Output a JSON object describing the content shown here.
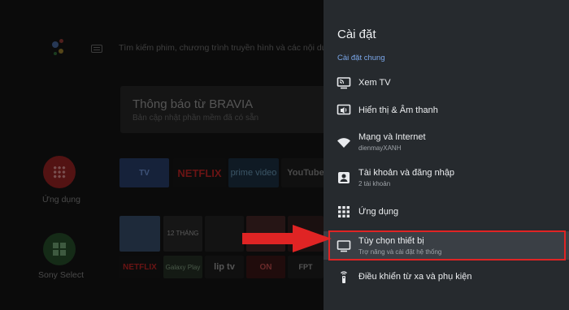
{
  "home": {
    "search_hint": "Tìm kiếm phim, chương trình truyền hình và các nội dung khác",
    "notification": {
      "title": "Thông báo từ BRAVIA",
      "subtitle": "Bản cập nhật phần mềm đã có sẵn"
    },
    "apps_label": "Ứng dụng",
    "sony_select_label": "Sony Select",
    "tiles": {
      "live_tv": "TV",
      "netflix": "NETFLIX",
      "prime": "prime video",
      "youtube": "YouTube",
      "movie2": "12 THÁNG",
      "netflix2": "NETFLIX",
      "galaxy_play": "Galaxy Play",
      "liptv": "lip tv",
      "on": "ON",
      "fpt": "FPT"
    }
  },
  "settings": {
    "title": "Cài đặt",
    "section": "Cài đặt chung",
    "items": [
      {
        "label": "Xem TV",
        "sub": "",
        "icon": "tv-icon"
      },
      {
        "label": "Hiển thị & Âm thanh",
        "sub": "",
        "icon": "display-sound-icon"
      },
      {
        "label": "Mạng và Internet",
        "sub": "dienmayXANH",
        "icon": "wifi-icon"
      },
      {
        "label": "Tài khoản và đăng nhập",
        "sub": "2 tài khoản",
        "icon": "account-icon"
      },
      {
        "label": "Ứng dụng",
        "sub": "",
        "icon": "apps-grid-icon"
      },
      {
        "label": "Tùy chọn thiết bị",
        "sub": "Trợ năng và cài đặt hệ thống",
        "icon": "monitor-icon"
      },
      {
        "label": "Điều khiển từ xa và phụ kiện",
        "sub": "",
        "icon": "remote-icon"
      }
    ],
    "selected_index": 5
  },
  "colors": {
    "panel_bg": "#262a2e",
    "section_accent": "#7aa6e8",
    "highlight_red": "#e02424"
  }
}
